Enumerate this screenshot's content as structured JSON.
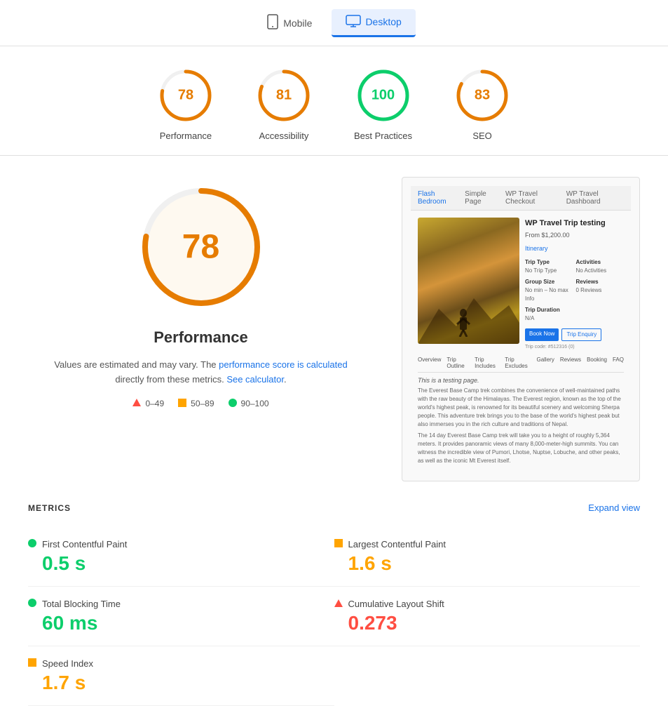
{
  "tabs": [
    {
      "id": "mobile",
      "label": "Mobile",
      "active": false,
      "icon": "📱"
    },
    {
      "id": "desktop",
      "label": "Desktop",
      "active": true,
      "icon": "💻"
    }
  ],
  "scores": [
    {
      "id": "performance",
      "value": 78,
      "label": "Performance",
      "color": "#e67c00",
      "strokeColor": "#e67c00",
      "percent": 78
    },
    {
      "id": "accessibility",
      "value": 81,
      "label": "Accessibility",
      "color": "#e67c00",
      "strokeColor": "#e67c00",
      "percent": 81
    },
    {
      "id": "best-practices",
      "value": 100,
      "label": "Best Practices",
      "color": "#0cce6b",
      "strokeColor": "#0cce6b",
      "percent": 100
    },
    {
      "id": "seo",
      "value": 83,
      "label": "SEO",
      "color": "#e67c00",
      "strokeColor": "#e67c00",
      "percent": 83
    }
  ],
  "big_score": {
    "value": 78,
    "label": "Performance",
    "description_start": "Values are estimated and may vary. The ",
    "description_link": "performance score is calculated",
    "description_mid": " directly from these metrics. ",
    "description_link2": "See calculator",
    "description_end": "."
  },
  "legend": [
    {
      "id": "fail",
      "icon": "triangle",
      "color": "#ff4e42",
      "label": "0–49"
    },
    {
      "id": "average",
      "icon": "square",
      "color": "#ffa400",
      "label": "50–89"
    },
    {
      "id": "pass",
      "icon": "circle",
      "color": "#0cce6b",
      "label": "90–100"
    }
  ],
  "metrics_title": "METRICS",
  "expand_label": "Expand view",
  "metrics": [
    {
      "id": "fcp",
      "name": "First Contentful Paint",
      "value": "0.5 s",
      "status": "green",
      "icon": "circle"
    },
    {
      "id": "lcp",
      "name": "Largest Contentful Paint",
      "value": "1.6 s",
      "status": "orange",
      "icon": "square"
    },
    {
      "id": "tbt",
      "name": "Total Blocking Time",
      "value": "60 ms",
      "status": "green",
      "icon": "circle"
    },
    {
      "id": "cls",
      "name": "Cumulative Layout Shift",
      "value": "0.273",
      "status": "red",
      "icon": "triangle"
    },
    {
      "id": "si",
      "name": "Speed Index",
      "value": "1.7 s",
      "status": "orange",
      "icon": "square"
    }
  ],
  "screenshot": {
    "header_items": [
      "Flash Bedroom",
      "Simple Page",
      "WP Travel Checkout",
      "WP Travel Dashboard"
    ],
    "title": "WP Travel Trip testing",
    "subtitle": "From $1,200.00"
  }
}
